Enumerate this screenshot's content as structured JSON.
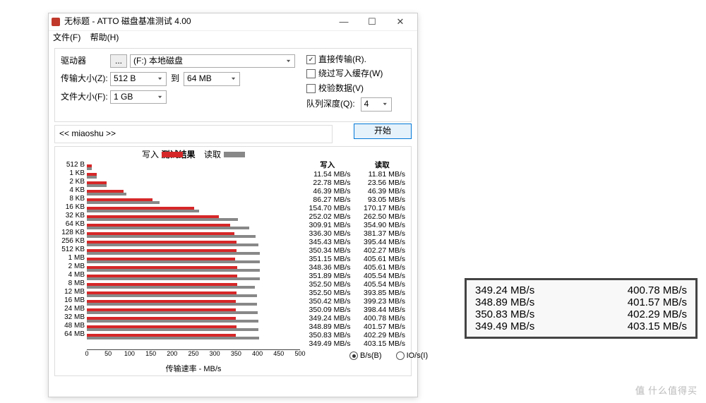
{
  "window": {
    "title": "无标题 - ATTO 磁盘基准测试 4.00"
  },
  "menu": {
    "file": "文件(F)",
    "help": "帮助(H)"
  },
  "winctl": {
    "min": "—",
    "max": "☐",
    "close": "✕"
  },
  "form": {
    "drive_label": "驱动器",
    "drive_btn": "...",
    "drive_value": "(F:) 本地磁盘",
    "xfer_label": "传输大小(Z):",
    "xfer_from": "512 B",
    "xfer_to_lbl": "到",
    "xfer_to": "64 MB",
    "file_label": "文件大小(F):",
    "file_value": "1 GB"
  },
  "opts": {
    "direct": "直接传输(R).",
    "bypass": "绕过写入缓存(W)",
    "verify": "校验数据(V)",
    "qd_label": "队列深度(Q):",
    "qd_value": "4",
    "start": "开始"
  },
  "status": "<< miaoshu >>",
  "chart": {
    "title": "测试结果",
    "write": "写入",
    "read": "读取",
    "xlabel": "传输速率 - MB/s",
    "unit_b": "B/s(B)",
    "unit_io": "IO/s(I)"
  },
  "chart_data": {
    "type": "bar",
    "orientation": "horizontal",
    "xlim": [
      0,
      500
    ],
    "ticks": [
      0,
      50,
      100,
      150,
      200,
      250,
      300,
      350,
      400,
      450,
      500
    ],
    "series": [
      {
        "name": "写入",
        "color": "#d62728"
      },
      {
        "name": "读取",
        "color": "#888"
      }
    ],
    "categories": [
      "512 B",
      "1 KB",
      "2 KB",
      "4 KB",
      "8 KB",
      "16 KB",
      "32 KB",
      "64 KB",
      "128 KB",
      "256 KB",
      "512 KB",
      "1 MB",
      "2 MB",
      "4 MB",
      "8 MB",
      "12 MB",
      "16 MB",
      "24 MB",
      "32 MB",
      "48 MB",
      "64 MB"
    ],
    "write": [
      11.54,
      22.78,
      46.39,
      86.27,
      154.7,
      252.02,
      309.91,
      336.3,
      345.43,
      350.34,
      351.15,
      348.36,
      351.89,
      352.5,
      352.5,
      350.42,
      350.09,
      349.24,
      348.89,
      350.83,
      349.49
    ],
    "read": [
      11.81,
      23.56,
      46.39,
      93.05,
      170.17,
      262.5,
      354.9,
      381.37,
      395.44,
      402.27,
      405.61,
      405.61,
      405.54,
      405.54,
      393.85,
      399.23,
      398.44,
      400.78,
      401.57,
      402.29,
      403.15
    ],
    "unit": "MB/s"
  },
  "callout": [
    {
      "w": "349.24 MB/s",
      "r": "400.78 MB/s"
    },
    {
      "w": "348.89 MB/s",
      "r": "401.57 MB/s"
    },
    {
      "w": "350.83 MB/s",
      "r": "402.29 MB/s"
    },
    {
      "w": "349.49 MB/s",
      "r": "403.15 MB/s"
    }
  ],
  "watermark": "什么值得买"
}
